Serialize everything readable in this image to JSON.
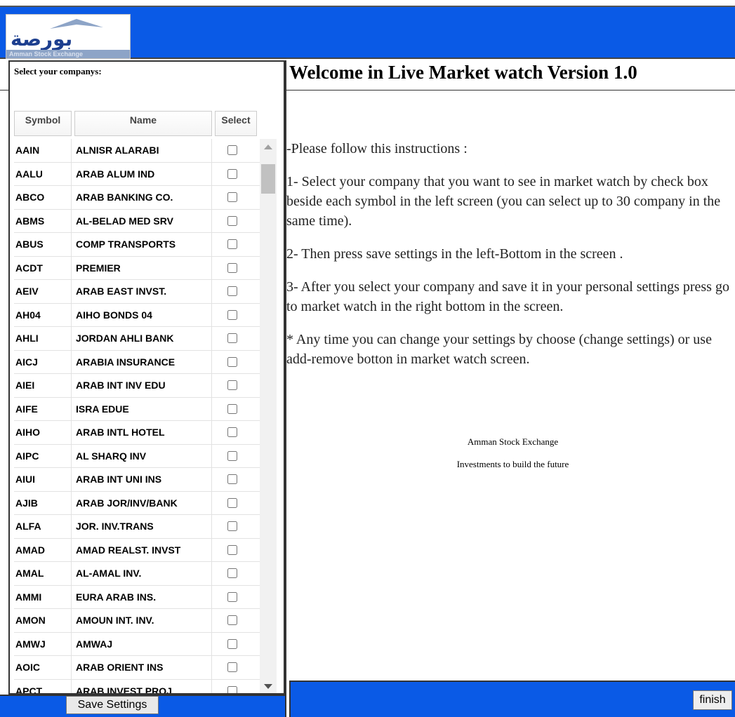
{
  "header": {
    "logo_ar": "بورصة عمان",
    "logo_en": "Amman Stock Exchange"
  },
  "left": {
    "label": "Select your companys:",
    "columns": [
      "Symbol",
      "Name",
      "Select"
    ],
    "rows": [
      {
        "symbol": "AAIN",
        "name": "ALNISR ALARABI"
      },
      {
        "symbol": "AALU",
        "name": "ARAB ALUM IND"
      },
      {
        "symbol": "ABCO",
        "name": "ARAB BANKING CO."
      },
      {
        "symbol": "ABMS",
        "name": "AL-BELAD MED SRV"
      },
      {
        "symbol": "ABUS",
        "name": "COMP TRANSPORTS"
      },
      {
        "symbol": "ACDT",
        "name": "PREMIER"
      },
      {
        "symbol": "AEIV",
        "name": "ARAB EAST INVST."
      },
      {
        "symbol": "AH04",
        "name": "AIHO BONDS 04"
      },
      {
        "symbol": "AHLI",
        "name": "JORDAN AHLI BANK"
      },
      {
        "symbol": "AICJ",
        "name": "ARABIA INSURANCE"
      },
      {
        "symbol": "AIEI",
        "name": "ARAB INT INV EDU"
      },
      {
        "symbol": "AIFE",
        "name": "ISRA EDUE"
      },
      {
        "symbol": "AIHO",
        "name": "ARAB INTL HOTEL"
      },
      {
        "symbol": "AIPC",
        "name": "AL SHARQ INV"
      },
      {
        "symbol": "AIUI",
        "name": "ARAB INT UNI INS"
      },
      {
        "symbol": "AJIB",
        "name": "ARAB JOR/INV/BANK"
      },
      {
        "symbol": "ALFA",
        "name": "JOR. INV.TRANS"
      },
      {
        "symbol": "AMAD",
        "name": "AMAD REALST. INVST"
      },
      {
        "symbol": "AMAL",
        "name": "AL-AMAL INV."
      },
      {
        "symbol": "AMMI",
        "name": "EURA ARAB INS."
      },
      {
        "symbol": "AMON",
        "name": "AMOUN INT. INV."
      },
      {
        "symbol": "AMWJ",
        "name": "AMWAJ"
      },
      {
        "symbol": "AOIC",
        "name": "ARAB ORIENT INS"
      },
      {
        "symbol": "APCT",
        "name": "ARAB INVEST PROJ"
      }
    ],
    "save_label": "Save Settings"
  },
  "right": {
    "title": "Welcome in Live Market watch Version 1.0",
    "instructions": [
      "-Please follow this instructions :",
      "1- Select your company that you want to see in market watch by check box beside each symbol in the left screen (you can select up to 30 company in the same time).",
      "2- Then press save settings in the left-Bottom in the screen .",
      "3- After you select your company and save it in your personal settings press go to market watch in the right bottom in the screen.",
      "* Any time you can change your settings by choose (change settings) or use add-remove botton in market watch screen."
    ],
    "footer_line1": "Amman Stock Exchange",
    "footer_line2": "Investments to build the future",
    "finish_label": "finish"
  },
  "colors": {
    "bar_blue": "#0a5ae6"
  }
}
